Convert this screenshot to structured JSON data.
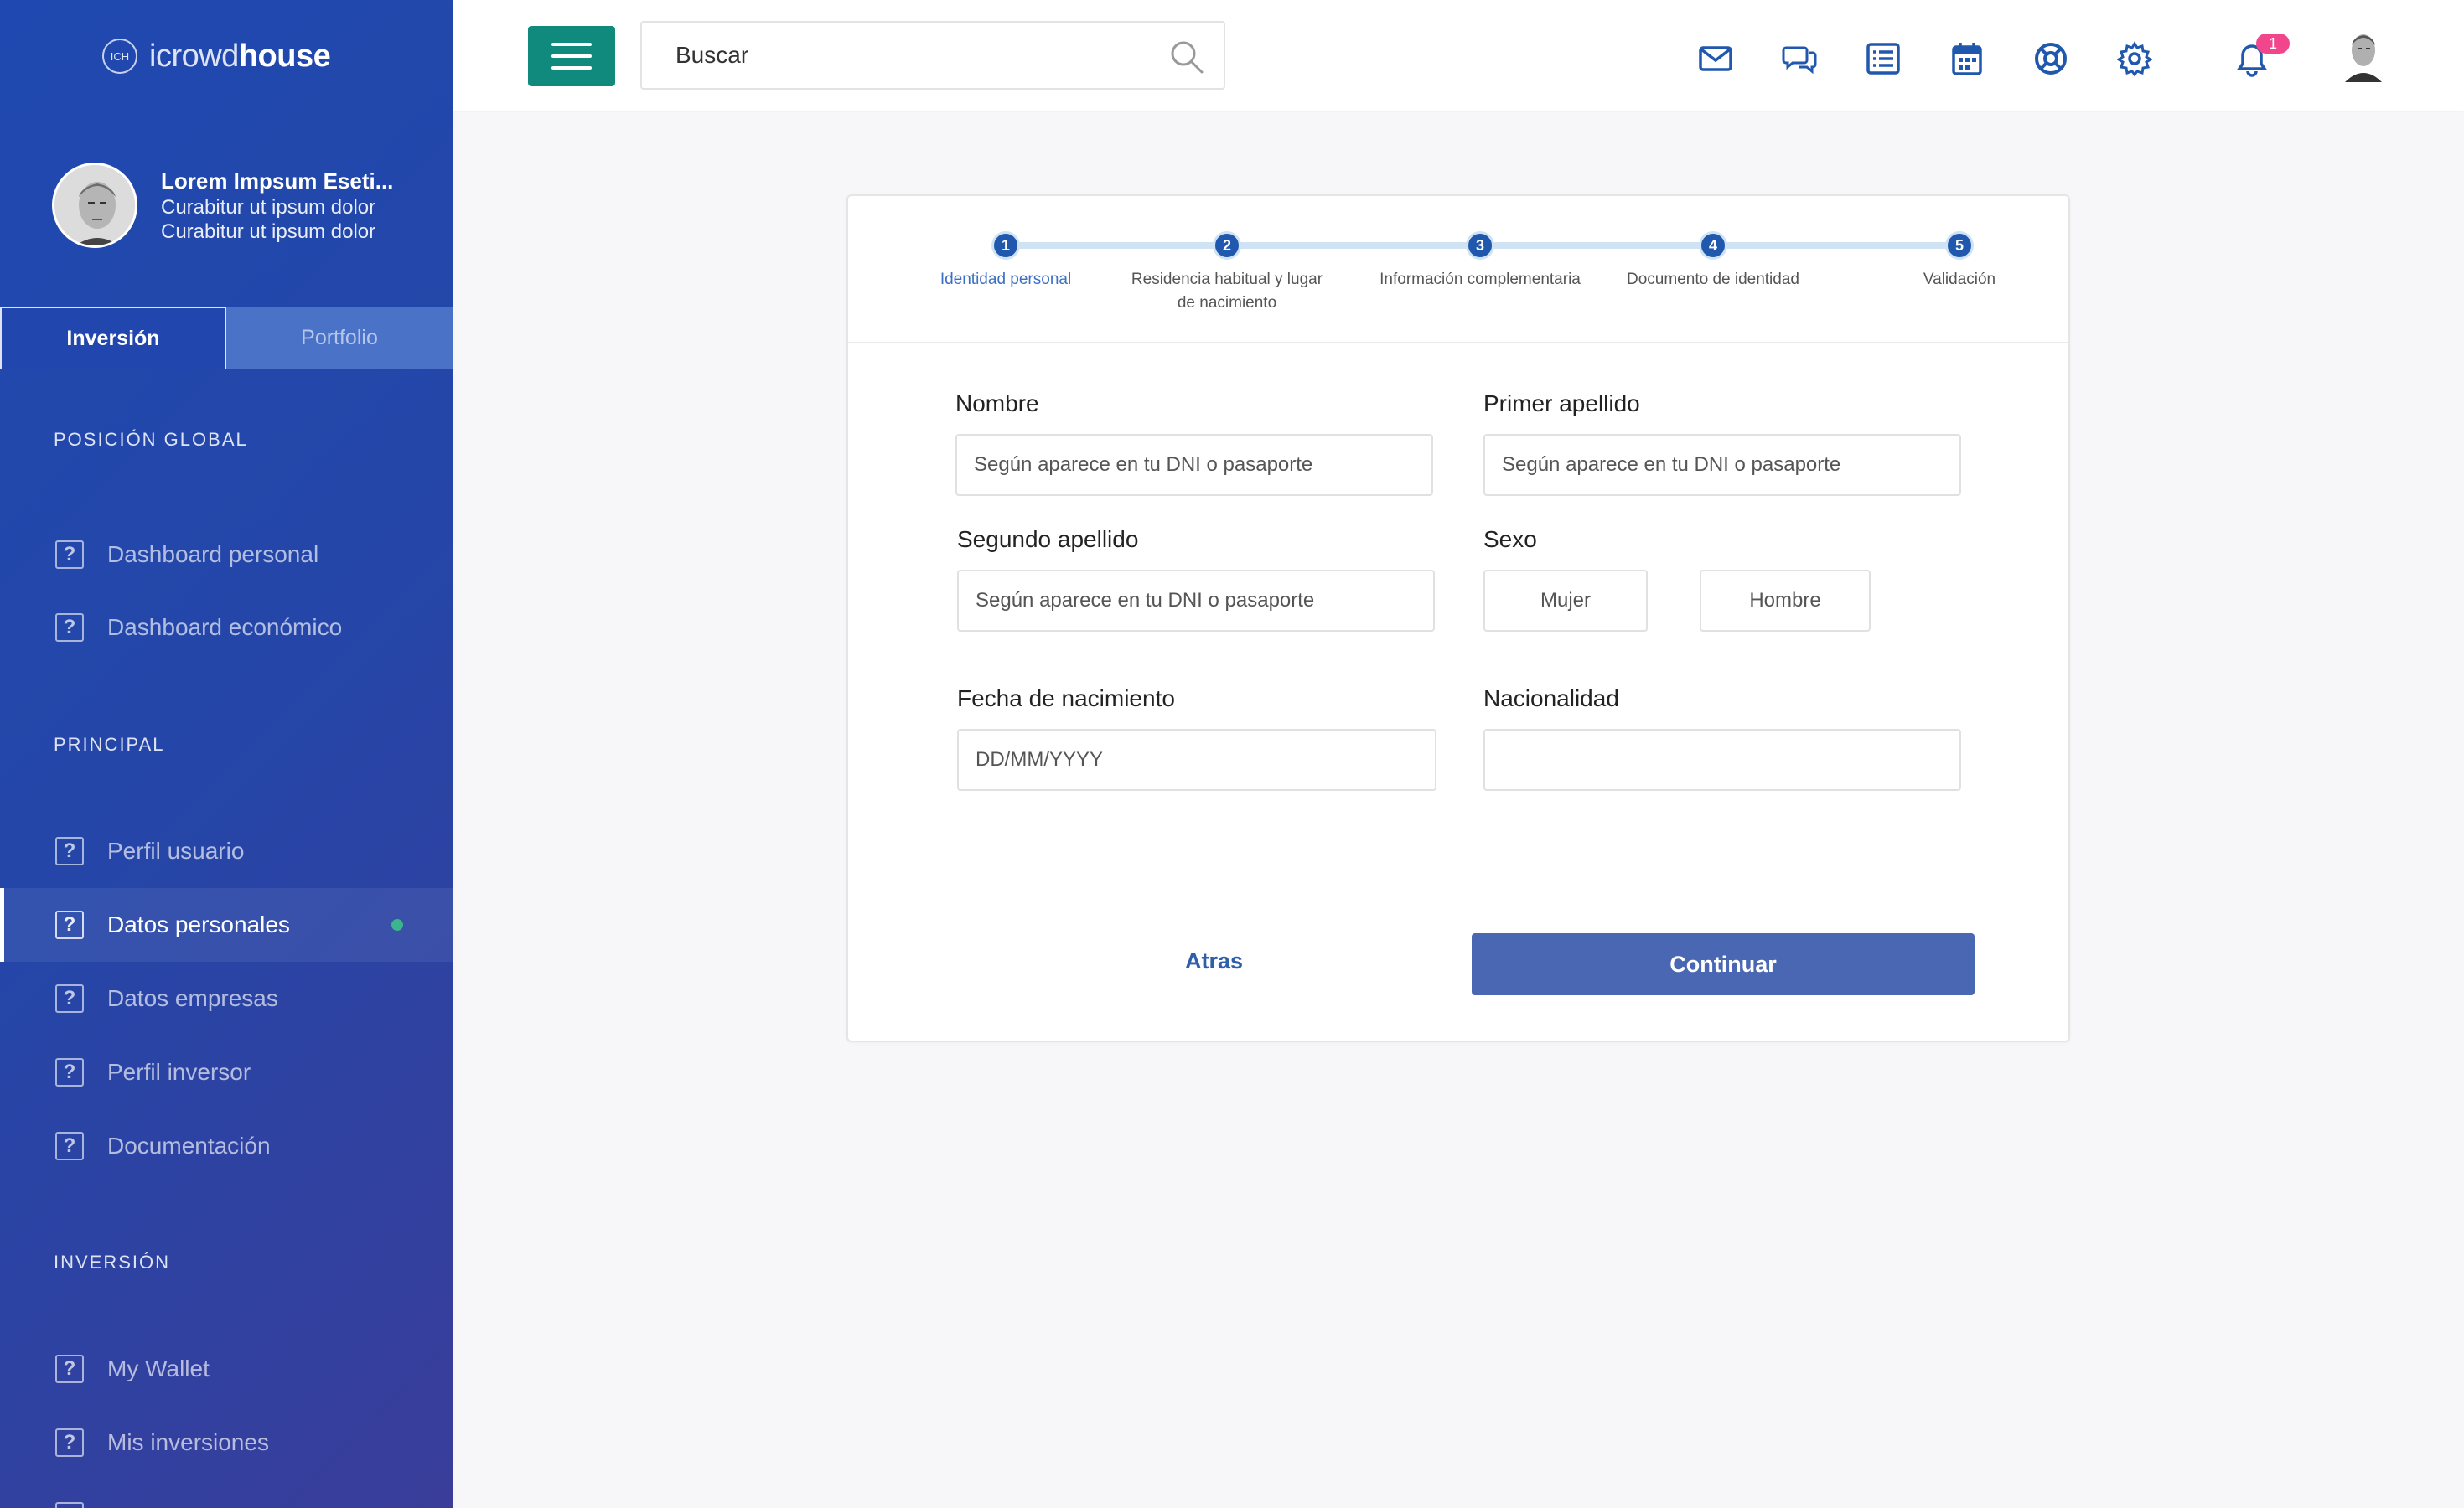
{
  "brand": {
    "logo_mark": "ICH",
    "logo_light": "icrowd",
    "logo_bold": "house"
  },
  "profile": {
    "name": "Lorem Impsum Eseti...",
    "line1": "Curabitur ut ipsum dolor",
    "line2": "Curabitur ut ipsum dolor"
  },
  "sidebar_tabs": [
    {
      "label": "Inversión",
      "active": true
    },
    {
      "label": "Portfolio",
      "active": false
    }
  ],
  "sections": {
    "global": "POSICIÓN GLOBAL",
    "principal": "PRINCIPAL",
    "inversion": "INVERSIÓN"
  },
  "nav": {
    "global": [
      "Dashboard personal",
      "Dashboard económico"
    ],
    "principal": [
      "Perfil usuario",
      "Datos personales",
      "Datos empresas",
      "Perfil inversor",
      "Documentación"
    ],
    "inversion": [
      "My Wallet",
      "Mis inversiones"
    ],
    "active_item": "Datos personales"
  },
  "topbar": {
    "search_placeholder": "Buscar",
    "icons": [
      "mail-icon",
      "chat-icon",
      "list-icon",
      "calendar-icon",
      "support-icon",
      "gear-icon",
      "bell-icon"
    ],
    "notification_count": "1"
  },
  "stepper": {
    "steps": [
      {
        "num": "1",
        "label": "Identidad personal",
        "current": true
      },
      {
        "num": "2",
        "label": "Residencia habitual y lugar de nacimiento"
      },
      {
        "num": "3",
        "label": "Información complementaria"
      },
      {
        "num": "4",
        "label": "Documento de identidad"
      },
      {
        "num": "5",
        "label": "Validación"
      }
    ]
  },
  "form": {
    "nombre": {
      "label": "Nombre",
      "placeholder": "Según aparece en tu DNI o pasaporte"
    },
    "primer_apellido": {
      "label": "Primer apellido",
      "placeholder": "Según aparece en tu DNI o pasaporte"
    },
    "segundo_apellido": {
      "label": "Segundo apellido",
      "placeholder": "Según aparece en tu DNI o pasaporte"
    },
    "sexo": {
      "label": "Sexo",
      "options": [
        "Mujer",
        "Hombre"
      ]
    },
    "fecha": {
      "label": "Fecha de nacimiento",
      "placeholder": "DD/MM/YYYY"
    },
    "nacionalidad": {
      "label": "Nacionalidad",
      "placeholder": ""
    },
    "back_label": "Atras",
    "continue_label": "Continuar"
  },
  "colors": {
    "accent": "#118a7e",
    "primary": "#1f58ad",
    "cta": "#4a67b3",
    "badge": "#f2468c"
  }
}
